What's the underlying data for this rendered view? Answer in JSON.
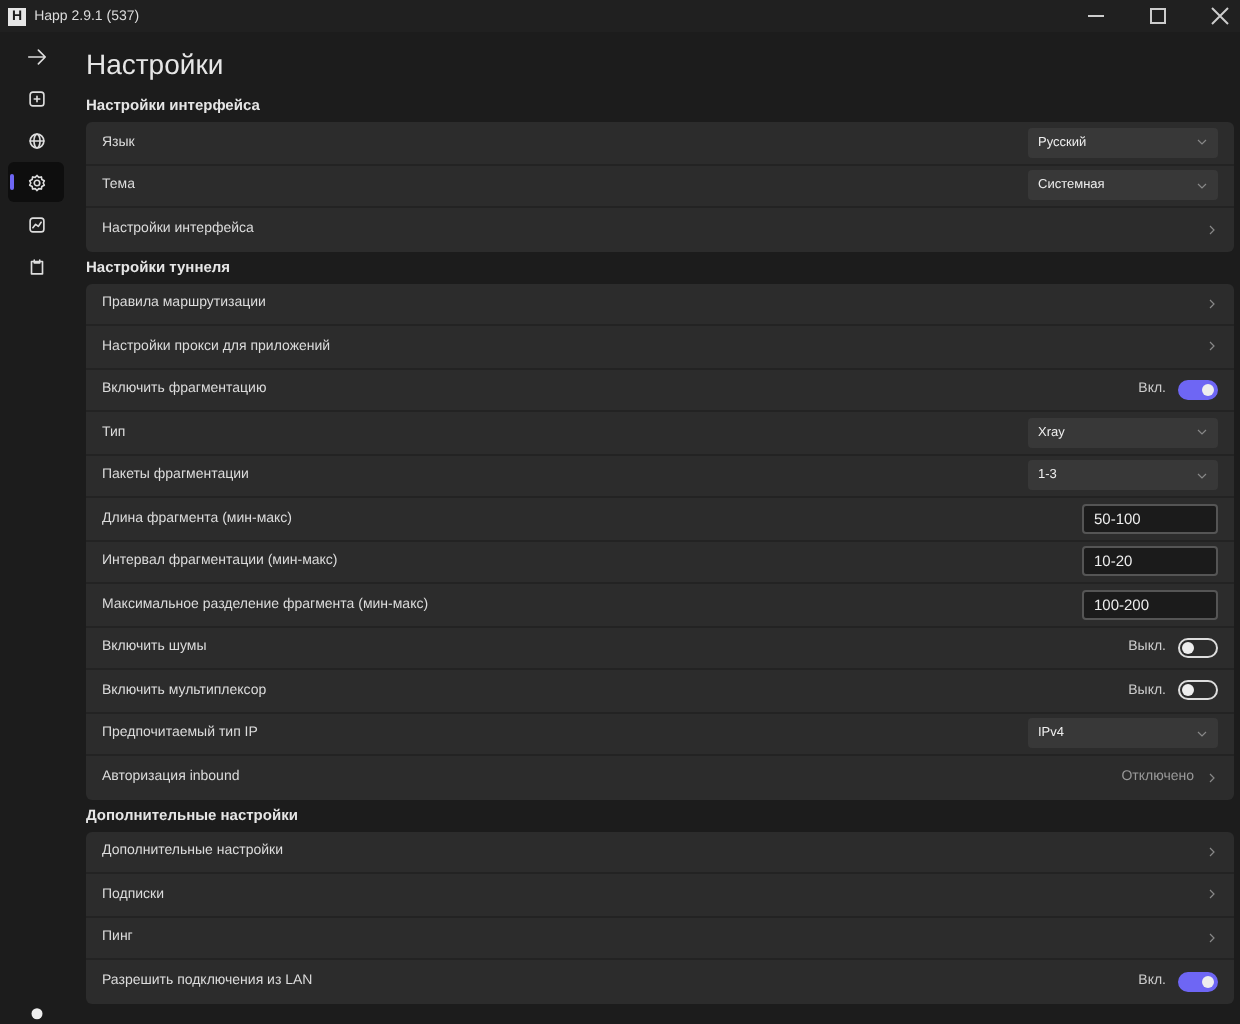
{
  "window": {
    "logo": "H",
    "title": "Happ 2.9.1 (537)"
  },
  "sidebar": {
    "items": [
      {
        "selected": false
      },
      {
        "selected": false
      },
      {
        "selected": false
      },
      {
        "selected": true
      },
      {
        "selected": false
      },
      {
        "selected": false
      },
      {
        "selected": false
      }
    ]
  },
  "page_title": "Настройки",
  "sections": [
    {
      "title": "Настройки интерфейса",
      "rows": [
        {
          "kind": "select",
          "label": "Язык",
          "value": "Русский"
        },
        {
          "kind": "select",
          "label": "Тема",
          "value": "Системная"
        },
        {
          "kind": "nav",
          "label": "Настройки интерфейса"
        }
      ]
    },
    {
      "title": "Настройки туннеля",
      "rows": [
        {
          "kind": "nav",
          "label": "Правила маршрутизации"
        },
        {
          "kind": "nav",
          "label": "Настройки прокси для приложений"
        },
        {
          "kind": "toggle",
          "label": "Включить фрагментацию",
          "state_label": "Вкл.",
          "on": true
        },
        {
          "kind": "select",
          "label": "Тип",
          "value": "Xray"
        },
        {
          "kind": "select",
          "label": "Пакеты фрагментации",
          "value": "1-3"
        },
        {
          "kind": "input",
          "label": "Длина фрагмента (мин-макс)",
          "value": "50-100"
        },
        {
          "kind": "input",
          "label": "Интервал фрагментации (мин-макс)",
          "value": "10-20"
        },
        {
          "kind": "input",
          "label": "Максимальное разделение фрагмента (мин-макс)",
          "value": "100-200"
        },
        {
          "kind": "toggle",
          "label": "Включить шумы",
          "state_label": "Выкл.",
          "on": false
        },
        {
          "kind": "toggle",
          "label": "Включить мультиплексор",
          "state_label": "Выкл.",
          "on": false
        },
        {
          "kind": "select",
          "label": "Предпочитаемый тип IP",
          "value": "IPv4"
        },
        {
          "kind": "nav",
          "label": "Авторизация inbound",
          "value": "Отключено"
        }
      ]
    },
    {
      "title": "Дополнительные настройки",
      "rows": [
        {
          "kind": "nav",
          "label": "Дополнительные настройки"
        },
        {
          "kind": "nav",
          "label": "Подписки"
        },
        {
          "kind": "nav",
          "label": "Пинг"
        },
        {
          "kind": "toggle",
          "label": "Разрешить подключения из LAN",
          "state_label": "Вкл.",
          "on": true
        }
      ]
    }
  ]
}
